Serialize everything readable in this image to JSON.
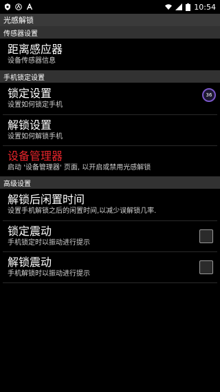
{
  "status_bar": {
    "time": "10:54",
    "icons": [
      "shield-icon",
      "a-circle-icon",
      "a-icon",
      "wifi-icon",
      "signal-icon",
      "battery-icon"
    ]
  },
  "app": {
    "title": "光感解锁"
  },
  "sections": {
    "sensor": {
      "header": "传感器设置",
      "items": [
        {
          "title": "距离感应器",
          "summary": "设备传感器信息"
        }
      ]
    },
    "lock": {
      "header": "手机锁定设置",
      "items": [
        {
          "title": "锁定设置",
          "summary": "设置如何锁定手机"
        },
        {
          "title": "解锁设置",
          "summary": "设置如何解锁手机"
        },
        {
          "title": "设备管理器",
          "summary": "启动 '设备管理器' 页面, 以开启或禁用光感解锁"
        }
      ]
    },
    "advanced": {
      "header": "高级设置",
      "items": [
        {
          "title": "解锁后闲置时间",
          "summary": "设置手机解锁之后的闲置时间,以减少误解锁几率."
        },
        {
          "title": "锁定震动",
          "summary": "手机锁定时以振动进行提示"
        },
        {
          "title": "解锁震动",
          "summary": "手机解锁时以振动进行提示"
        }
      ]
    }
  },
  "badge": {
    "value": "36"
  },
  "colors": {
    "accent_red": "#e8252b",
    "badge_ring": "#7a56c9",
    "header_bg": "#323232"
  }
}
